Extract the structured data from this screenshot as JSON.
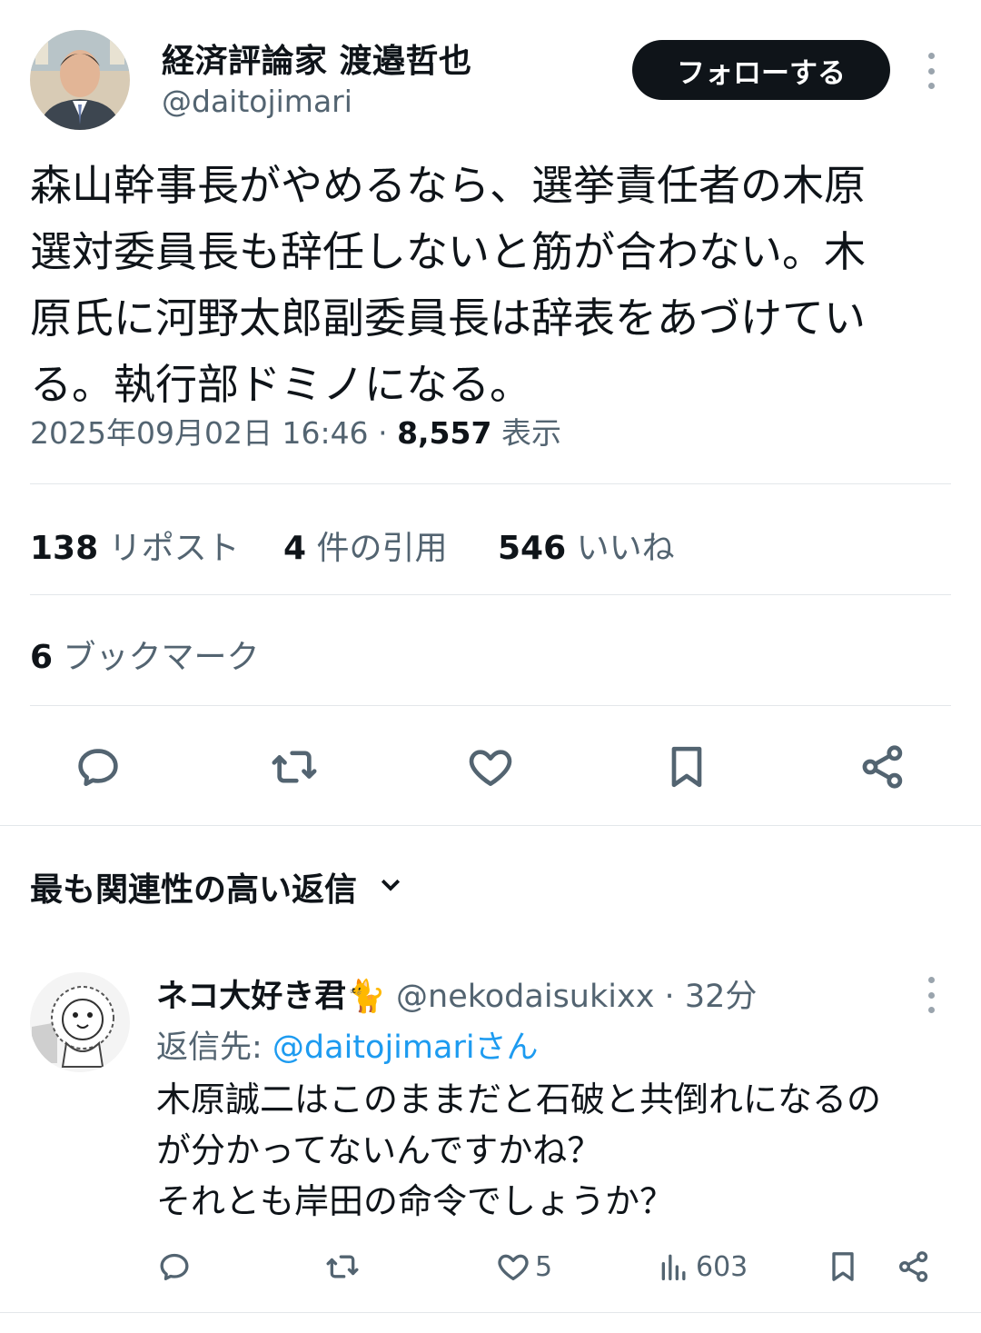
{
  "tweet": {
    "display_name": "経済評論家 渡邉哲也",
    "handle": "@daitojimari",
    "follow_label": "フォローする",
    "text": "森山幹事長がやめるなら、選挙責任者の木原\n選対委員長も辞任しないと筋が合わない。木\n原氏に河野太郎副委員長は辞表をあづけてい\nる。執行部ドミノになる。",
    "timestamp": "2025年09月02日 16:46",
    "separator": "·",
    "views_count": "8,557",
    "views_label": "表示"
  },
  "stats": {
    "reposts_count": "138",
    "reposts_label": "リポスト",
    "quotes_count": "4",
    "quotes_label": "件の引用",
    "likes_count": "546",
    "likes_label": "いいね",
    "bookmarks_count": "6",
    "bookmarks_label": "ブックマーク"
  },
  "actions": [
    "reply-icon",
    "repost-icon",
    "like-icon",
    "bookmark-icon",
    "share-icon"
  ],
  "replies_section": {
    "title": "最も関連性の高い返信"
  },
  "reply": {
    "display_name": "ネコ大好き君🐈",
    "handle": "@nekodaisukixx",
    "separator": "·",
    "time": "32分",
    "reply_to_prefix": "返信先: ",
    "reply_to_mention": "@daitojimariさん",
    "text": "木原誠二はこのままだと石破と共倒れになるの\nが分かってないんですかね？\nそれとも岸田の命令でしょうか？",
    "likes": "5",
    "views": "603"
  },
  "colors": {
    "text": "#0f1419",
    "secondary": "#536471",
    "link": "#1d9bf0",
    "divider": "#e3e7ea",
    "button": "#0f1419"
  }
}
